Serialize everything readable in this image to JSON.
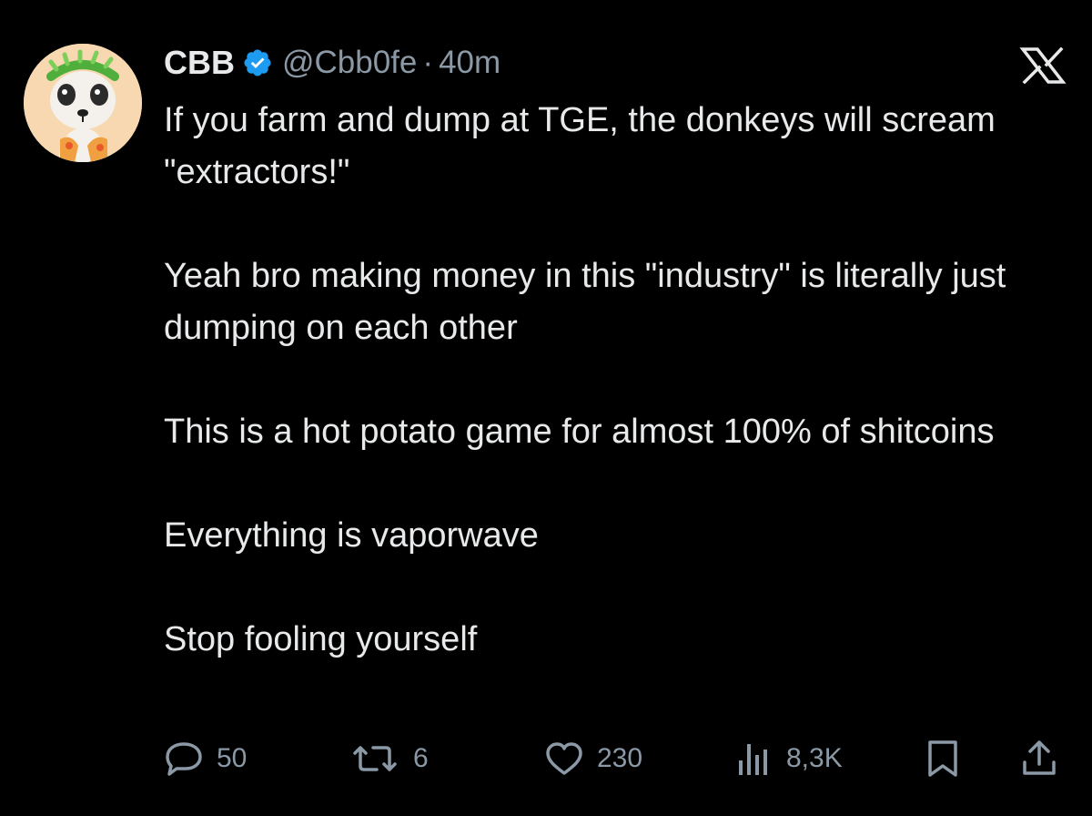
{
  "author": {
    "name": "CBB",
    "handle": "@Cbb0fe",
    "separator": "·",
    "time": "40m",
    "avatar_icon": "avatar-image",
    "verified_icon": "verified-badge-icon"
  },
  "tweet": {
    "paragraphs": [
      "If you farm and dump at TGE, the donkeys will scream \"extractors!\"",
      "Yeah bro making money in this \"industry\" is literally just dumping on each other",
      "This is a hot potato game for almost 100% of shitcoins",
      "Everything is vaporwave",
      "Stop fooling yourself"
    ]
  },
  "actions": {
    "replies": "50",
    "reposts": "6",
    "likes": "230",
    "views": "8,3K"
  },
  "colors": {
    "background": "#000000",
    "text": "#e7e9ea",
    "muted": "#8b98a5",
    "verified": "#1d9bf0"
  }
}
